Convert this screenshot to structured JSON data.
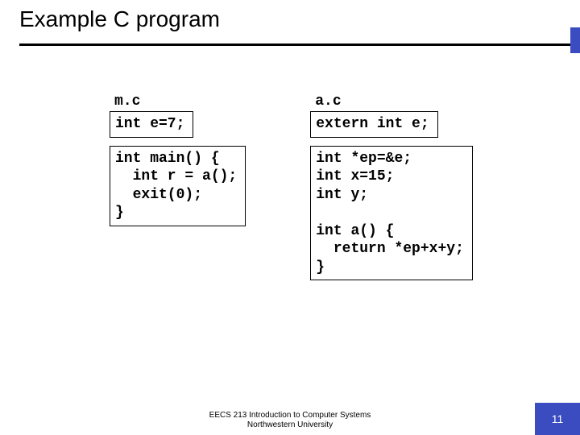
{
  "title": "Example C program",
  "left": {
    "filename": "m.c",
    "box1": "int e=7;",
    "box2": "int main() {\n  int r = a();\n  exit(0);\n}"
  },
  "right": {
    "filename": "a.c",
    "box1": "extern int e;",
    "box2": "int *ep=&e;\nint x=15;\nint y;\n\nint a() {\n  return *ep+x+y;\n}"
  },
  "footer": {
    "line1": "EECS 213 Introduction to Computer Systems",
    "line2": "Northwestern University"
  },
  "page": "11"
}
